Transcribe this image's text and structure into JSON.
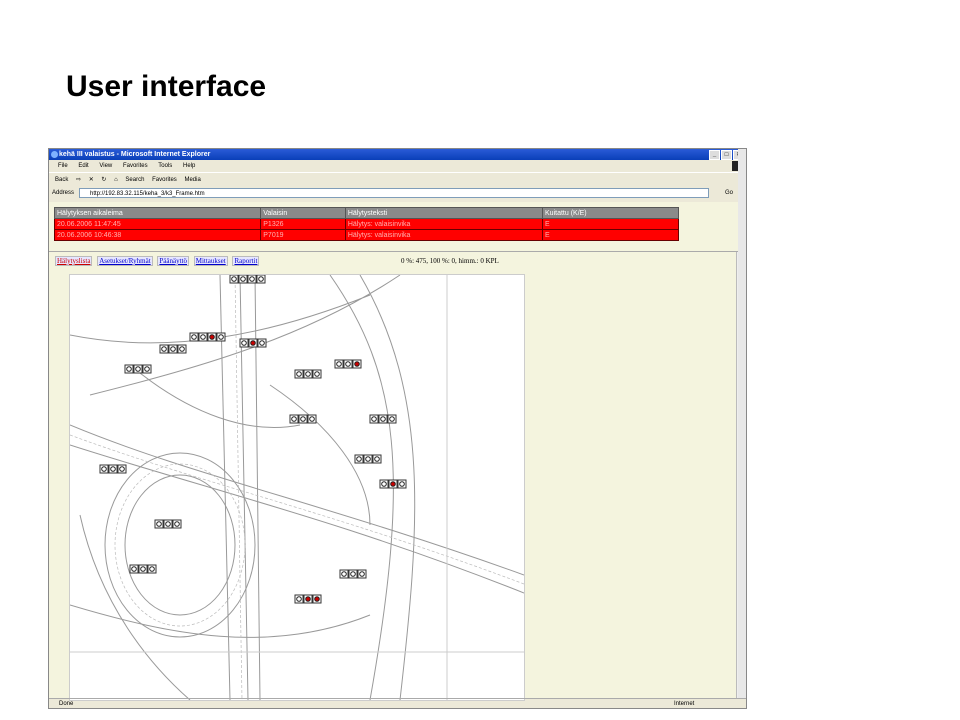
{
  "slide": {
    "title": "User interface"
  },
  "browser": {
    "title": "kehä III valaistus - Microsoft Internet Explorer",
    "menu": [
      "File",
      "Edit",
      "View",
      "Favorites",
      "Tools",
      "Help"
    ],
    "toolbar": [
      "Back",
      "Search",
      "Favorites",
      "Media"
    ],
    "address_label": "Address",
    "url": "http://192.83.32.115/keha_3/k3_Frame.htm",
    "go_label": "Go",
    "status_left": "Done",
    "status_zone": "Internet"
  },
  "alarms": {
    "headers": [
      "Hälytyksen aikaleima",
      "Valaisin",
      "Hälytysteksti",
      "Kuitattu (K/E)"
    ],
    "rows": [
      [
        "20.06.2006 11:47:45",
        "P1326",
        "Hälytys: valaisinvika",
        "E"
      ],
      [
        "20.06.2006 10:46:38",
        "P7019",
        "Hälytys: valaisinvika",
        "E"
      ]
    ]
  },
  "nav": {
    "links": [
      "Hälytyslista",
      "Asetukset/Ryhmät",
      "Päänäyttö",
      "Mittaukset",
      "Raportit"
    ]
  },
  "status_line": "0 %: 475, 100 %: 0, himm.: 0 KPL",
  "map": {
    "lamp_color": "#222222",
    "fault_color": "#cc0000",
    "lamps": [
      [
        0,
        0,
        0,
        0
      ],
      [
        0,
        0,
        1,
        0
      ],
      [
        0,
        0,
        0
      ],
      [
        0,
        1,
        0
      ],
      [
        0,
        0,
        0
      ],
      [
        0,
        0,
        1
      ],
      [
        0,
        0,
        0
      ],
      [
        0,
        0,
        0
      ],
      [
        0,
        0,
        0
      ],
      [
        0,
        0,
        0
      ],
      [
        0,
        0,
        0
      ],
      [
        0,
        1,
        0
      ],
      [
        0,
        0,
        0
      ],
      [
        0,
        0,
        0
      ],
      [
        0,
        1,
        1
      ],
      [
        0,
        0,
        0
      ]
    ]
  },
  "colors": {
    "alarm_row": "#ff0000",
    "header_row": "#8a8a8a",
    "page_bg": "#F4F4DE"
  }
}
